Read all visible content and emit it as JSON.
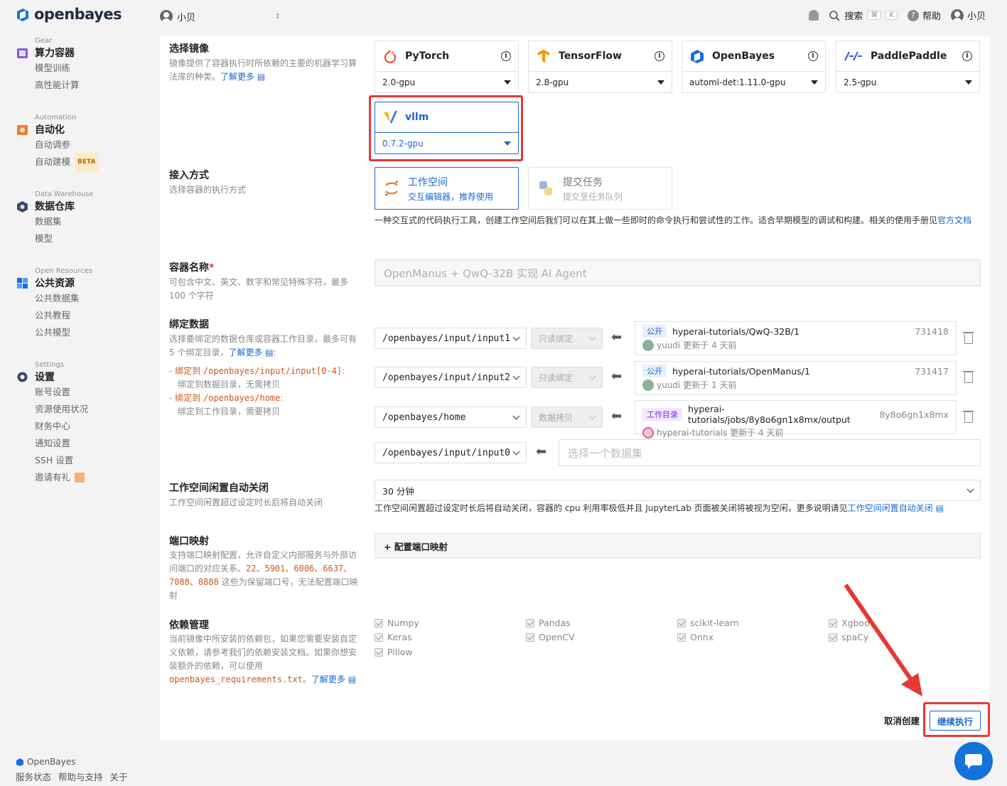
{
  "brand": {
    "name": "openbayes",
    "footer_name": "OpenBayes"
  },
  "sidebar": {
    "groups": [
      {
        "en": "Gear",
        "label": "算力容器",
        "items": [
          "模型训练",
          "高性能计算"
        ]
      },
      {
        "en": "Automation",
        "label": "自动化",
        "items": [
          "自动调参",
          "自动建模"
        ],
        "badge": "BETA"
      },
      {
        "en": "Data Warehouse",
        "label": "数据仓库",
        "items": [
          "数据集",
          "模型"
        ]
      },
      {
        "en": "Open Resources",
        "label": "公共资源",
        "items": [
          "公共数据集",
          "公共教程",
          "公共模型"
        ]
      },
      {
        "en": "Settings",
        "label": "设置",
        "items": [
          "账号设置",
          "资源使用状况",
          "财务中心",
          "通知设置",
          "SSH 设置",
          "邀请有礼"
        ]
      }
    ],
    "footer_links": [
      "服务状态",
      "帮助与支持",
      "关于"
    ]
  },
  "topbar": {
    "user": "小贝",
    "search": "搜索",
    "kbd1": "⌘",
    "kbd2": "K",
    "help": "帮助",
    "account": "小贝"
  },
  "image_section": {
    "title": "选择镜像",
    "desc": "镜像提供了容器执行时所依赖的主要的机器学习算法库的种类。",
    "link": "了解更多",
    "cards": [
      {
        "name": "PyTorch",
        "version": "2.0-gpu"
      },
      {
        "name": "TensorFlow",
        "version": "2.8-gpu"
      },
      {
        "name": "OpenBayes",
        "version": "automl-det:1.11.0-gpu"
      },
      {
        "name": "PaddlePaddle",
        "version": "2.5-gpu"
      },
      {
        "name": "vllm",
        "version": "0.7.2-gpu"
      }
    ]
  },
  "access_section": {
    "title": "接入方式",
    "desc": "选择容器的执行方式",
    "options": [
      {
        "t1": "工作空间",
        "t2": "交互编辑器，推荐使用"
      },
      {
        "t1": "提交任务",
        "t2": "提交至任务队列"
      }
    ],
    "note": "一种交互式的代码执行工具，创建工作空间后我们可以在其上做一些即时的命令执行和尝试性的工作。适合早期模型的调试和构建。相关的使用手册见",
    "note_link": "官方文档"
  },
  "name_section": {
    "title": "容器名称",
    "required": "*",
    "desc": "可包含中文、英文、数字和常见特殊字符，最多 100 个字符",
    "placeholder": "OpenManus + QwQ-32B 实现 AI Agent"
  },
  "bind_section": {
    "title": "绑定数据",
    "desc": "选择要绑定的数据仓库或容器工作目录，最多可有 5 个绑定目录，",
    "link": "了解更多",
    "rule1_a": "绑定到",
    "rule1_path": "/openbayes/input/input[0-4]",
    "rule1_b": "绑定到数据目录，无需拷贝",
    "rule2_a": "绑定到",
    "rule2_path": "/openbayes/home",
    "rule2_b": "绑定到工作目录，需要拷贝",
    "rows": [
      {
        "path": "/openbayes/input/input1",
        "mode": "只读绑定",
        "tag": "公开",
        "dataset": "hyperai-tutorials/QwQ-32B/1",
        "id": "731418",
        "user": "yuudi",
        "updated": "更新于 4 天前"
      },
      {
        "path": "/openbayes/input/input2",
        "mode": "只读绑定",
        "tag": "公开",
        "dataset": "hyperai-tutorials/OpenManus/1",
        "id": "731417",
        "user": "yuudi",
        "updated": "更新于 1 天前"
      },
      {
        "path": "/openbayes/home",
        "mode": "数据拷贝",
        "tag": "工作目录",
        "dataset": "hyperai-tutorials/jobs/8y8o6gn1x8mx/output",
        "id": "8y8o6gn1x8mx",
        "user": "hyperai-tutorials",
        "updated": "更新于 4 天前"
      }
    ],
    "empty_row": {
      "path": "/openbayes/input/input0",
      "placeholder": "选择一个数据集"
    }
  },
  "idle_section": {
    "title": "工作空间闲置自动关闭",
    "desc": "工作空间闲置超过设定时长后将自动关闭",
    "value": "30 分钟",
    "note": "工作空间闲置超过设定时长后将自动关闭，容器的 cpu 利用率极低并且 JupyterLab 页面被关闭将被视为空闲，更多说明请见",
    "note_link": "工作空间闲置自动关闭"
  },
  "port_section": {
    "title": "端口映射",
    "desc_a": "支持端口映射配置，允许自定义内部服务与外部访问端口的对应关系。",
    "ports": "22、5901、6006、6637、7088、8888",
    "desc_b": " 这些为保留端口号，无法配置端口映射",
    "button": "+ 配置端口映射"
  },
  "deps_section": {
    "title": "依赖管理",
    "desc": "当前镜像中所安装的依赖包，如果您需要安装自定义依赖，请参考我们的依赖安装文档。如果你想安装额外的依赖，可以使用",
    "file": "openbayes_requirements.txt",
    "link": "了解更多",
    "packages": [
      "Numpy",
      "Pandas",
      "scikit-learn",
      "Xgboo",
      "Keras",
      "OpenCV",
      "Onnx",
      "spaCy",
      "Pillow"
    ]
  },
  "actions": {
    "cancel": "取消创建",
    "next": "继续执行"
  },
  "colors": {
    "accent": "#1967d2",
    "highlight": "#e53935"
  }
}
